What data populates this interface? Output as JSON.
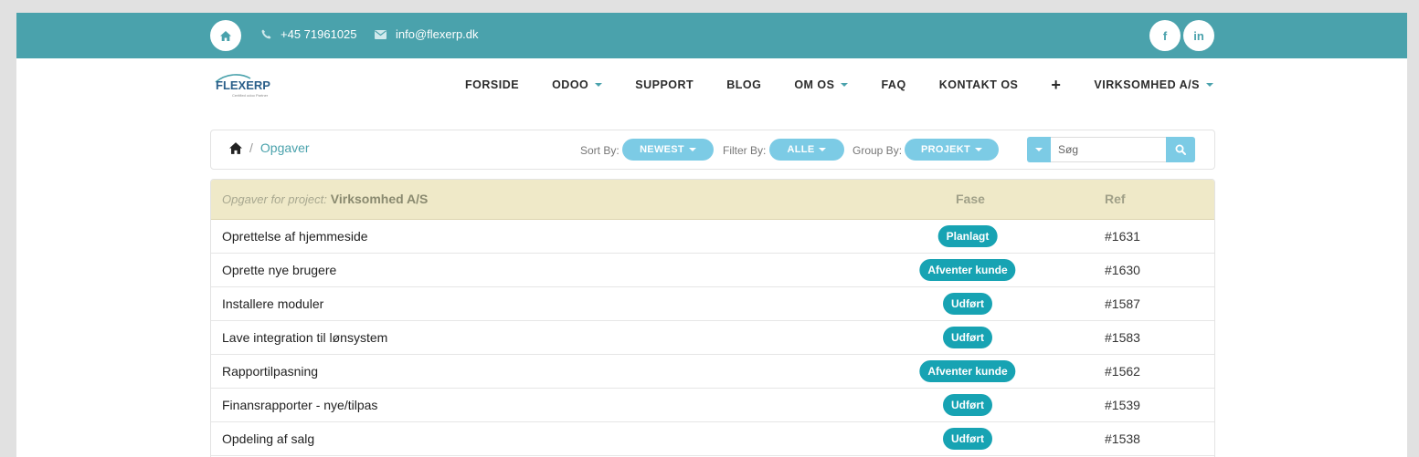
{
  "topbar": {
    "phone": "+45 71961025",
    "email": "info@flexerp.dk",
    "social": [
      "f",
      "in"
    ]
  },
  "logo": {
    "text": "FLEXERP",
    "tagline": "Certified odoo Partner"
  },
  "nav": {
    "items": [
      {
        "label": "FORSIDE",
        "dropdown": false
      },
      {
        "label": "ODOO",
        "dropdown": true
      },
      {
        "label": "SUPPORT",
        "dropdown": false
      },
      {
        "label": "BLOG",
        "dropdown": false
      },
      {
        "label": "OM OS",
        "dropdown": true
      },
      {
        "label": "FAQ",
        "dropdown": false
      },
      {
        "label": "KONTAKT OS",
        "dropdown": false
      },
      {
        "label": "+",
        "dropdown": false
      },
      {
        "label": "VIRKSOMHED A/S",
        "dropdown": true
      }
    ]
  },
  "breadcrumb": {
    "current": "Opgaver",
    "separator": "/"
  },
  "controls": {
    "sort_label": "Sort By:",
    "sort_value": "NEWEST",
    "filter_label": "Filter By:",
    "filter_value": "ALLE",
    "group_label": "Group By:",
    "group_value": "PROJEKT"
  },
  "search": {
    "placeholder": "Søg"
  },
  "table": {
    "lead": "Opgaver for project:",
    "project": "Virksomhed A/S",
    "col_fase": "Fase",
    "col_ref": "Ref",
    "rows": [
      {
        "name": "Oprettelse af hjemmeside",
        "stage": "Planlagt",
        "ref": "#1631"
      },
      {
        "name": "Oprette nye brugere",
        "stage": "Afventer kunde",
        "ref": "#1630"
      },
      {
        "name": "Installere moduler",
        "stage": "Udført",
        "ref": "#1587"
      },
      {
        "name": "Lave integration til lønsystem",
        "stage": "Udført",
        "ref": "#1583"
      },
      {
        "name": "Rapportilpasning",
        "stage": "Afventer kunde",
        "ref": "#1562"
      },
      {
        "name": "Finansrapporter - nye/tilpas",
        "stage": "Udført",
        "ref": "#1539"
      },
      {
        "name": "Opdeling af salg",
        "stage": "Udført",
        "ref": "#1538"
      }
    ]
  },
  "colors": {
    "brand": "#4aa2ac",
    "pill": "#7ccbe5",
    "badge": "#17a3b3",
    "header_bg": "#efe9c8"
  }
}
